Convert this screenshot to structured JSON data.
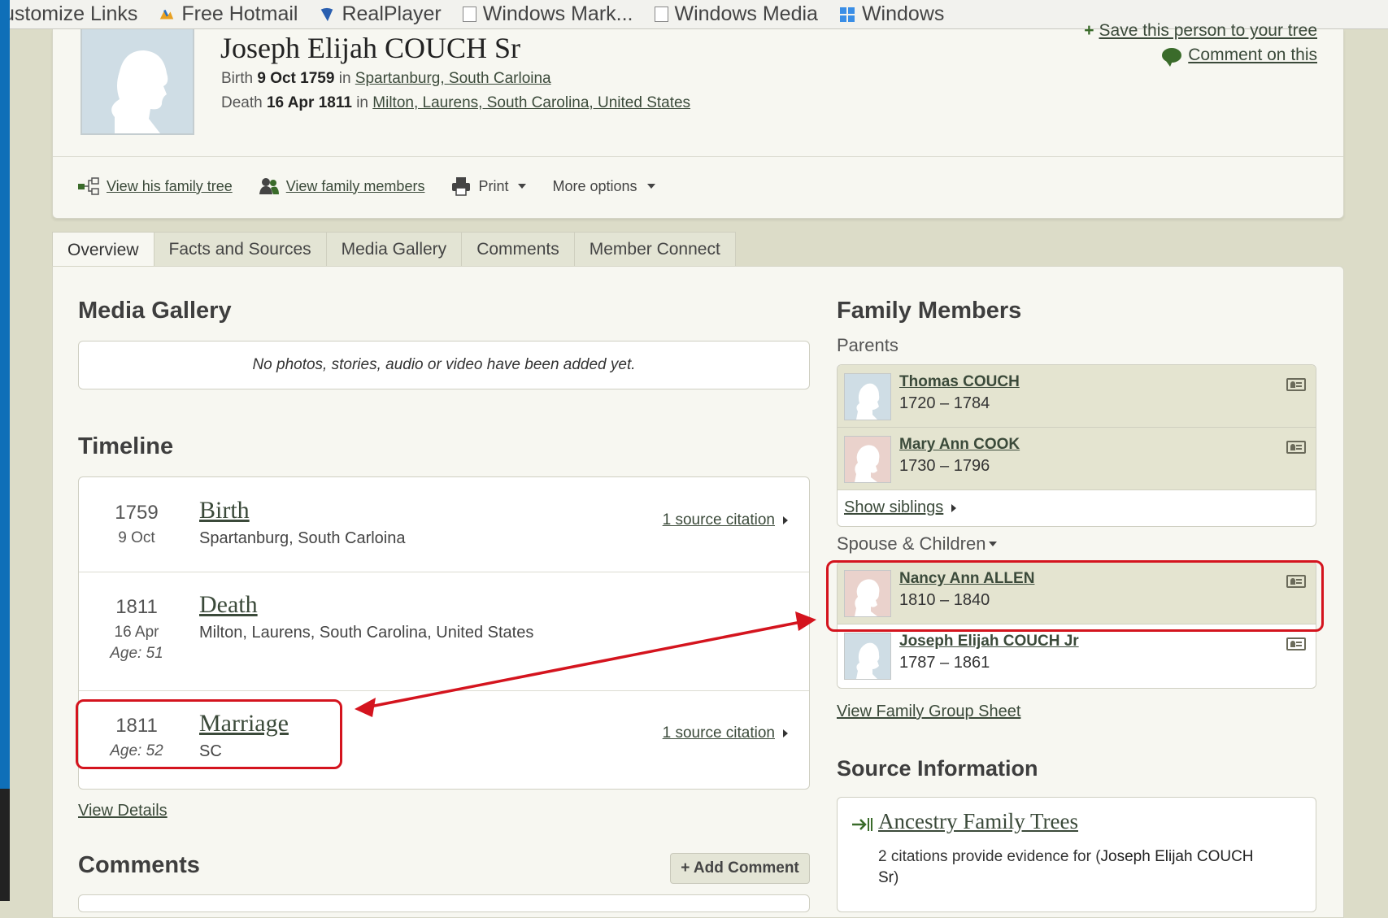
{
  "links_bar": {
    "items": [
      {
        "label": "ustomize Links",
        "icon": "none"
      },
      {
        "label": "Free Hotmail",
        "icon": "msn-icon"
      },
      {
        "label": "RealPlayer",
        "icon": "realplayer-icon"
      },
      {
        "label": "Windows Mark...",
        "icon": "page-icon"
      },
      {
        "label": "Windows Media",
        "icon": "page-icon"
      },
      {
        "label": "Windows",
        "icon": "windows-icon"
      }
    ]
  },
  "person": {
    "name": "Joseph Elijah COUCH Sr",
    "birth_label": "Birth",
    "birth_date": "9 Oct 1759",
    "birth_in": "in",
    "birth_place": "Spartanburg, South Carloina",
    "death_label": "Death",
    "death_date": "16 Apr 1811",
    "death_in": "in",
    "death_place": "Milton, Laurens, South Carolina, United States"
  },
  "header_links": {
    "save": "Save this person to your tree",
    "comment": "Comment on this"
  },
  "actions": {
    "family_tree": "View his family tree",
    "family_members": "View family members",
    "print": "Print",
    "more_options": "More options"
  },
  "tabs": [
    "Overview",
    "Facts and Sources",
    "Media Gallery",
    "Comments",
    "Member Connect"
  ],
  "media_gallery": {
    "title": "Media Gallery",
    "empty_text": "No photos, stories, audio or video have been added yet."
  },
  "timeline": {
    "title": "Timeline",
    "events": [
      {
        "year": "1759",
        "date": "9 Oct",
        "age": "",
        "event": "Birth",
        "place": "Spartanburg, South Carloina",
        "citation": "1 source citation"
      },
      {
        "year": "1811",
        "date": "16 Apr",
        "age": "Age: 51",
        "event": "Death",
        "place": "Milton, Laurens, South Carolina, United States",
        "citation": ""
      },
      {
        "year": "1811",
        "date": "",
        "age": "Age: 52",
        "event": "Marriage",
        "place": "SC",
        "citation": "1 source citation"
      }
    ],
    "view_details": "View Details"
  },
  "comments": {
    "title": "Comments",
    "add_button": "+ Add Comment"
  },
  "family": {
    "title": "Family Members",
    "parents_label": "Parents",
    "parents": [
      {
        "name": "Thomas COUCH",
        "years": "1720 – 1784"
      },
      {
        "name": "Mary Ann COOK",
        "years": "1730 – 1796"
      }
    ],
    "show_siblings": "Show siblings",
    "spouse_label": "Spouse & Children",
    "spouse_children": [
      {
        "name": "Nancy Ann ALLEN",
        "years": "1810 – 1840"
      },
      {
        "name": "Joseph Elijah COUCH Jr",
        "years": "1787 – 1861"
      }
    ],
    "group_sheet": "View Family Group Sheet"
  },
  "source_info": {
    "title": "Source Information",
    "source_name": "Ancestry Family Trees",
    "text_prefix": "2 citations provide evidence for (",
    "text_person": "Joseph Elijah COUCH Sr",
    "text_suffix": ")"
  },
  "colors": {
    "annotation": "#d4141e",
    "link": "#3b4a3a",
    "background": "#dcdcc8"
  }
}
